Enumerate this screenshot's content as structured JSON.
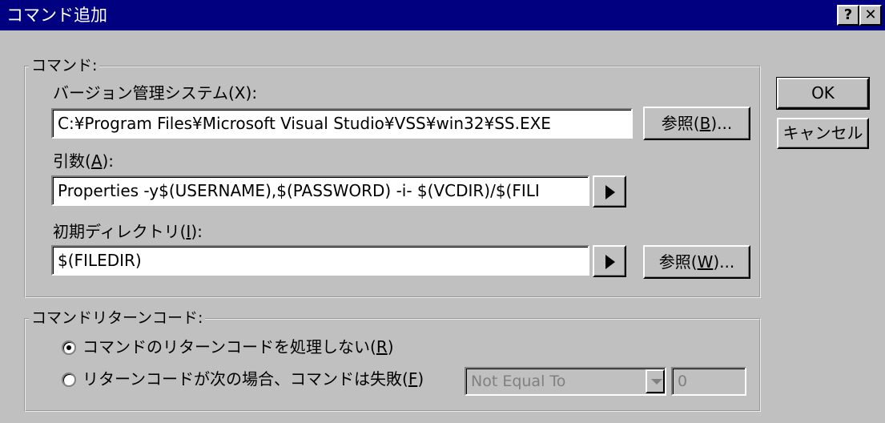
{
  "window": {
    "title": "コマンド追加",
    "help_label": "?",
    "close_label": "✕"
  },
  "command_group": {
    "title": "コマンド:",
    "vcs_label": "バージョン管理システム",
    "vcs_mnemonic": "(X)",
    "vcs_colon": ":",
    "vcs_value": "C:¥Program Files¥Microsoft Visual Studio¥VSS¥win32¥SS.EXE",
    "browse_b_label": "参照(",
    "browse_b_key": "B",
    "browse_b_tail": ")...",
    "args_label": "引数(",
    "args_key": "A",
    "args_tail": "):",
    "args_value": "Properties -y$(USERNAME),$(PASSWORD) -i- $(VCDIR)/$(FILI",
    "initdir_label": "初期ディレクトリ(",
    "initdir_key": "I",
    "initdir_tail": "):",
    "initdir_value": "$(FILEDIR)",
    "browse_w_label": "参照(",
    "browse_w_key": "W",
    "browse_w_tail": ")..."
  },
  "return_group": {
    "title": "コマンドリターンコード:",
    "option1_label": "コマンドのリターンコードを処理しない(",
    "option1_key": "R",
    "option1_tail": ")",
    "option1_selected": true,
    "option2_label": "リターンコードが次の場合、コマンドは失敗(",
    "option2_key": "F",
    "option2_tail": ")",
    "option2_selected": false,
    "condition_value": "Not Equal To",
    "code_value": "0"
  },
  "buttons": {
    "ok_label": "OK",
    "cancel_label": "キャンセル"
  },
  "icons": {
    "arrow": "right-triangle-icon",
    "dropdown": "chevron-down-icon"
  }
}
